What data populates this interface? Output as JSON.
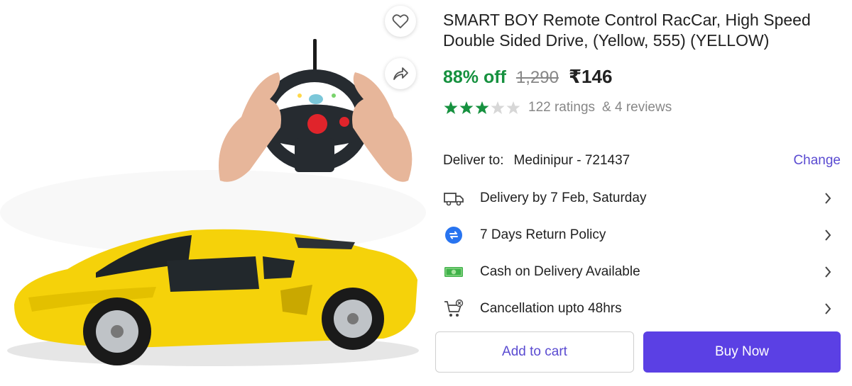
{
  "product": {
    "title": "SMART BOY Remote Control RacCar, High Speed Double Sided Drive, (Yellow, 555) (YELLOW)",
    "discount": "88% off",
    "mrp": "1,290",
    "price": "₹146",
    "rating_value": 3.5,
    "ratings_text": "122 ratings",
    "reviews_text": "& 4 reviews"
  },
  "image_actions": {
    "wishlist_icon": "heart-icon",
    "share_icon": "share-icon"
  },
  "delivery": {
    "label": "Deliver to:",
    "location": "Medinipur - 721437",
    "change_label": "Change"
  },
  "features": [
    {
      "icon": "truck-icon",
      "label": "Delivery by 7 Feb, Saturday"
    },
    {
      "icon": "return-icon",
      "label": "7 Days Return Policy"
    },
    {
      "icon": "cash-icon",
      "label": "Cash on Delivery Available"
    },
    {
      "icon": "cart-cancel-icon",
      "label": "Cancellation upto 48hrs"
    }
  ],
  "actions": {
    "add_to_cart": "Add to cart",
    "buy_now": "Buy Now"
  },
  "colors": {
    "discount_green": "#16913f",
    "star_green": "#16913f",
    "accent_purple": "#5b40e4",
    "link_purple": "#5a4bd1",
    "car_yellow": "#f5d20a"
  }
}
